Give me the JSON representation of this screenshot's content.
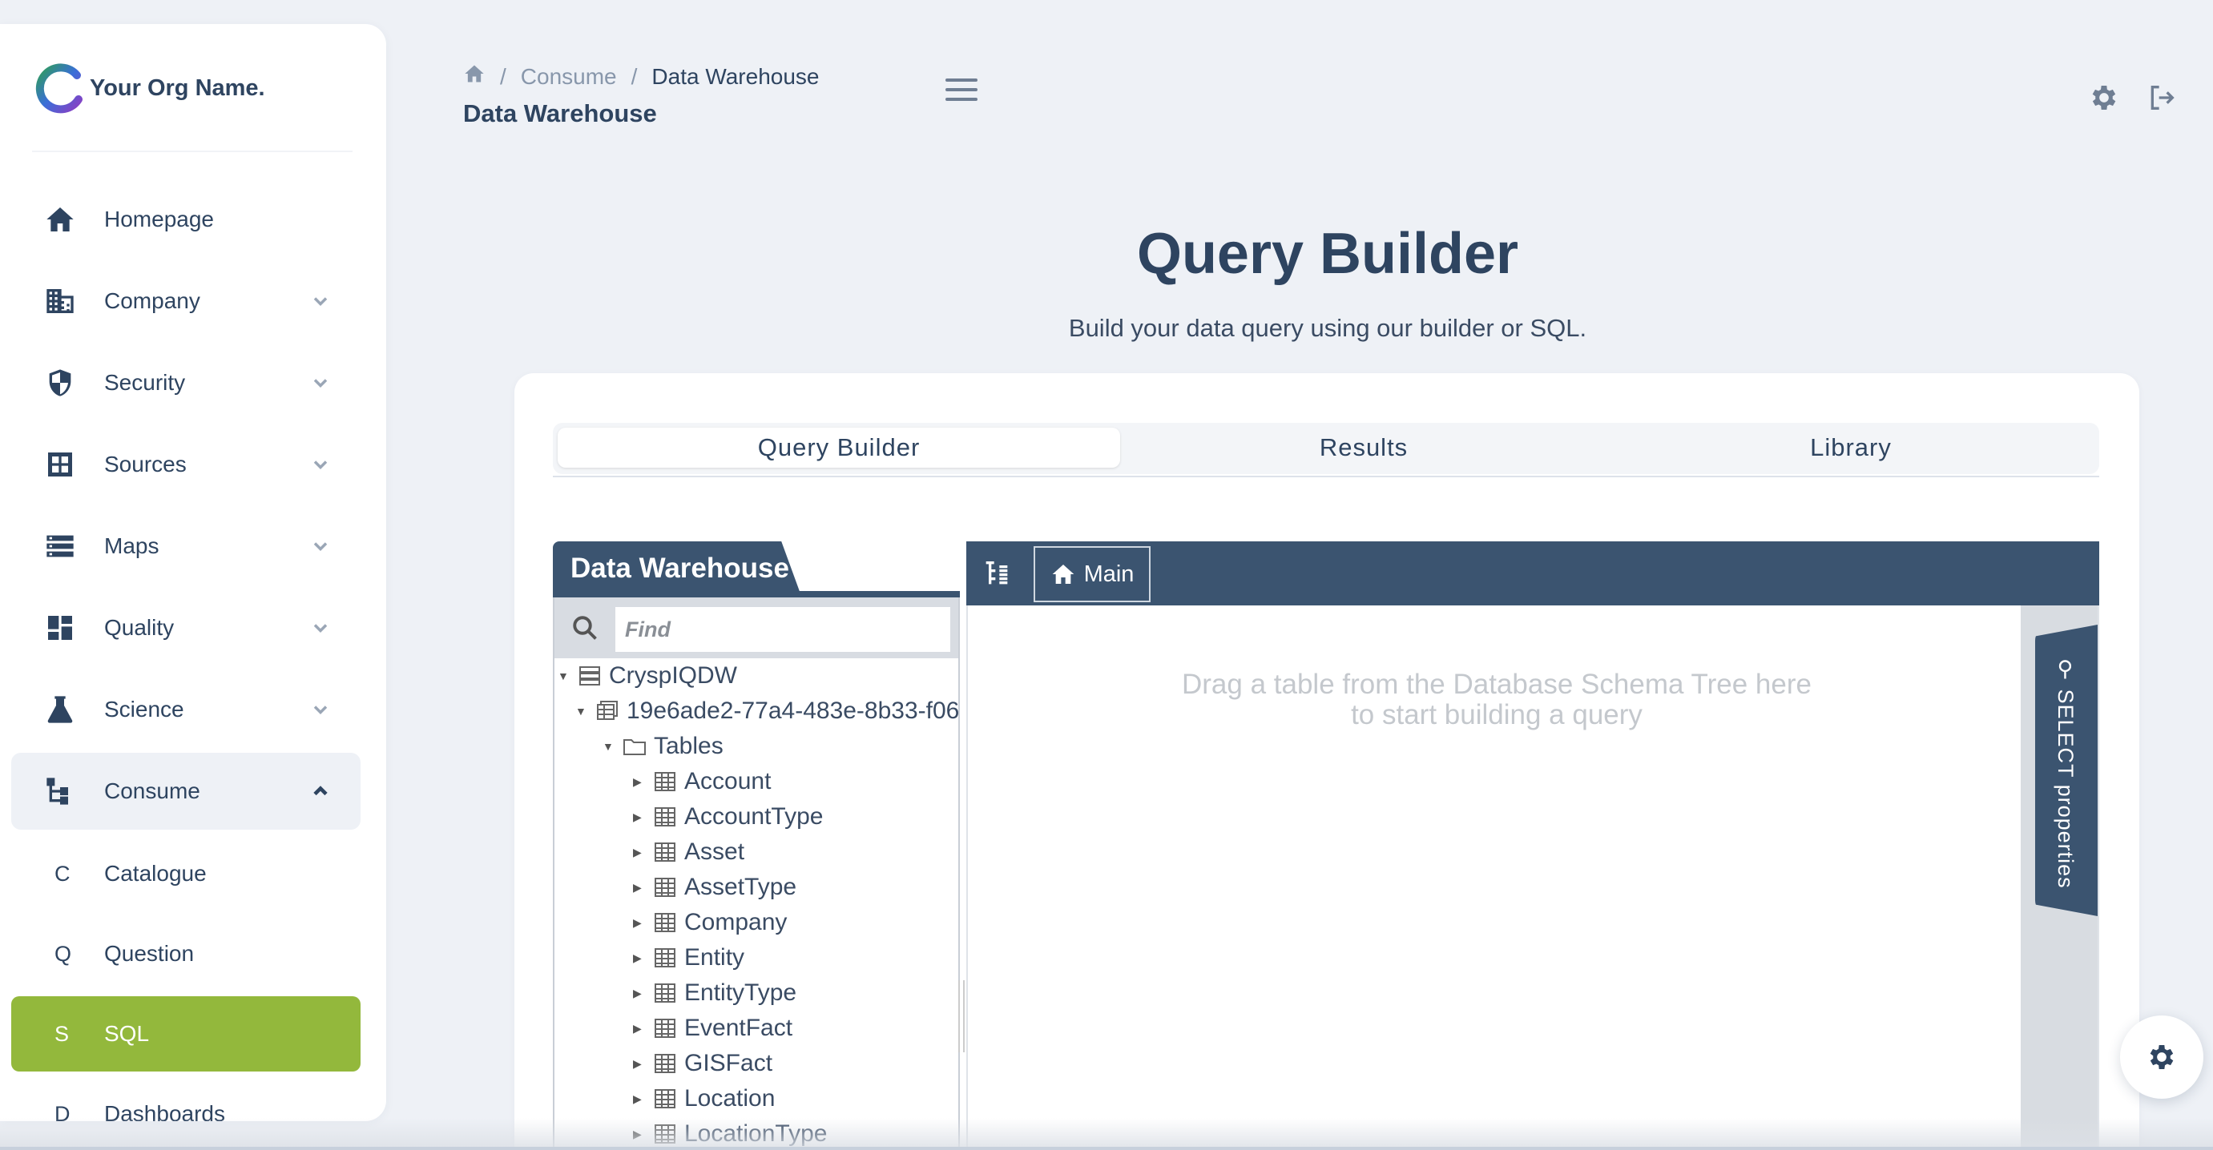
{
  "brand": {
    "name": "Your Org Name."
  },
  "sidebar": {
    "items": [
      {
        "label": "Homepage",
        "icon": "home-icon"
      },
      {
        "label": "Company",
        "icon": "building-icon"
      },
      {
        "label": "Security",
        "icon": "shield-icon"
      },
      {
        "label": "Sources",
        "icon": "grid-icon"
      },
      {
        "label": "Maps",
        "icon": "list-icon"
      },
      {
        "label": "Quality",
        "icon": "dashboard-icon"
      },
      {
        "label": "Science",
        "icon": "flask-icon"
      },
      {
        "label": "Consume",
        "icon": "flow-icon",
        "expanded": true
      }
    ],
    "sub_items": [
      {
        "letter": "C",
        "label": "Catalogue"
      },
      {
        "letter": "Q",
        "label": "Question"
      },
      {
        "letter": "S",
        "label": "SQL",
        "active": true
      },
      {
        "letter": "D",
        "label": "Dashboards"
      }
    ]
  },
  "header": {
    "breadcrumb": [
      "Consume",
      "Data Warehouse"
    ],
    "separator": "/",
    "subtitle": "Data Warehouse"
  },
  "page": {
    "title": "Query Builder",
    "description": "Build your data query using our builder or SQL."
  },
  "tabs": [
    {
      "label": "Query Builder",
      "active": true
    },
    {
      "label": "Results"
    },
    {
      "label": "Library"
    }
  ],
  "schema": {
    "title": "Data Warehouse",
    "find_placeholder": "Find",
    "root": "CryspIQDW",
    "database": "19e6ade2-77a4-483e-8b33-f06",
    "folder": "Tables",
    "tables": [
      "Account",
      "AccountType",
      "Asset",
      "AssetType",
      "Company",
      "Entity",
      "EntityType",
      "EventFact",
      "GISFact",
      "Location",
      "LocationType"
    ]
  },
  "canvas": {
    "main_label": "Main",
    "hint_line1": "Drag a table from the Database Schema Tree here",
    "hint_line2": "to start building a query",
    "properties_label": "SELECT properties"
  },
  "colors": {
    "primary": "#3b5470",
    "text": "#2e4460",
    "active_green": "#93b83c",
    "background": "#eef1f6"
  }
}
